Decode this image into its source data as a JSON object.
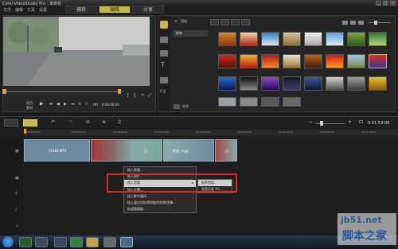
{
  "app": {
    "title": "Corel VideoStudio Pro - 未命名"
  },
  "menu": [
    "文件",
    "编辑",
    "工具",
    "设置"
  ],
  "steps": [
    {
      "label": "捕获"
    },
    {
      "label": "编辑"
    },
    {
      "label": "分享"
    }
  ],
  "player": {
    "modes": [
      "项目",
      "素材"
    ],
    "timecode": "0:00:00:00",
    "hd": "HD"
  },
  "library": {
    "add_label": "添加",
    "folder": "样本",
    "browse": "浏览"
  },
  "timeline": {
    "timecode": "0:01:53:08",
    "clips": [
      {
        "label": "01463.MTS"
      },
      {
        "label": "日"
      },
      {
        "label": "卧溪 .mpg"
      },
      {
        "label": "日"
      }
    ],
    "ruler_labels": [
      "00:00:00:00",
      "00:00:12:00",
      "00:00:24:00",
      "00:00:36:00",
      "00:00:48:00",
      "00:01:00:00",
      "00:01:12:00",
      "00:01:24:00",
      "00:01:36:00"
    ]
  },
  "context_menu": {
    "items": [
      "插入视频...",
      "插入照片...",
      "插入音频",
      "插入字幕...",
      "插入数字媒体...",
      "插入要应用轨透明度的视频/图像...",
      "轨道管理器..."
    ],
    "highlight_index": 2,
    "submenu": [
      "到声音轨...",
      "到音乐轨 #1..."
    ]
  },
  "colors": {
    "accent": "#c7b84a",
    "highlight_box": "#e0262b"
  },
  "watermark": {
    "text": "jb51.net",
    "cn": "脚本之家"
  }
}
